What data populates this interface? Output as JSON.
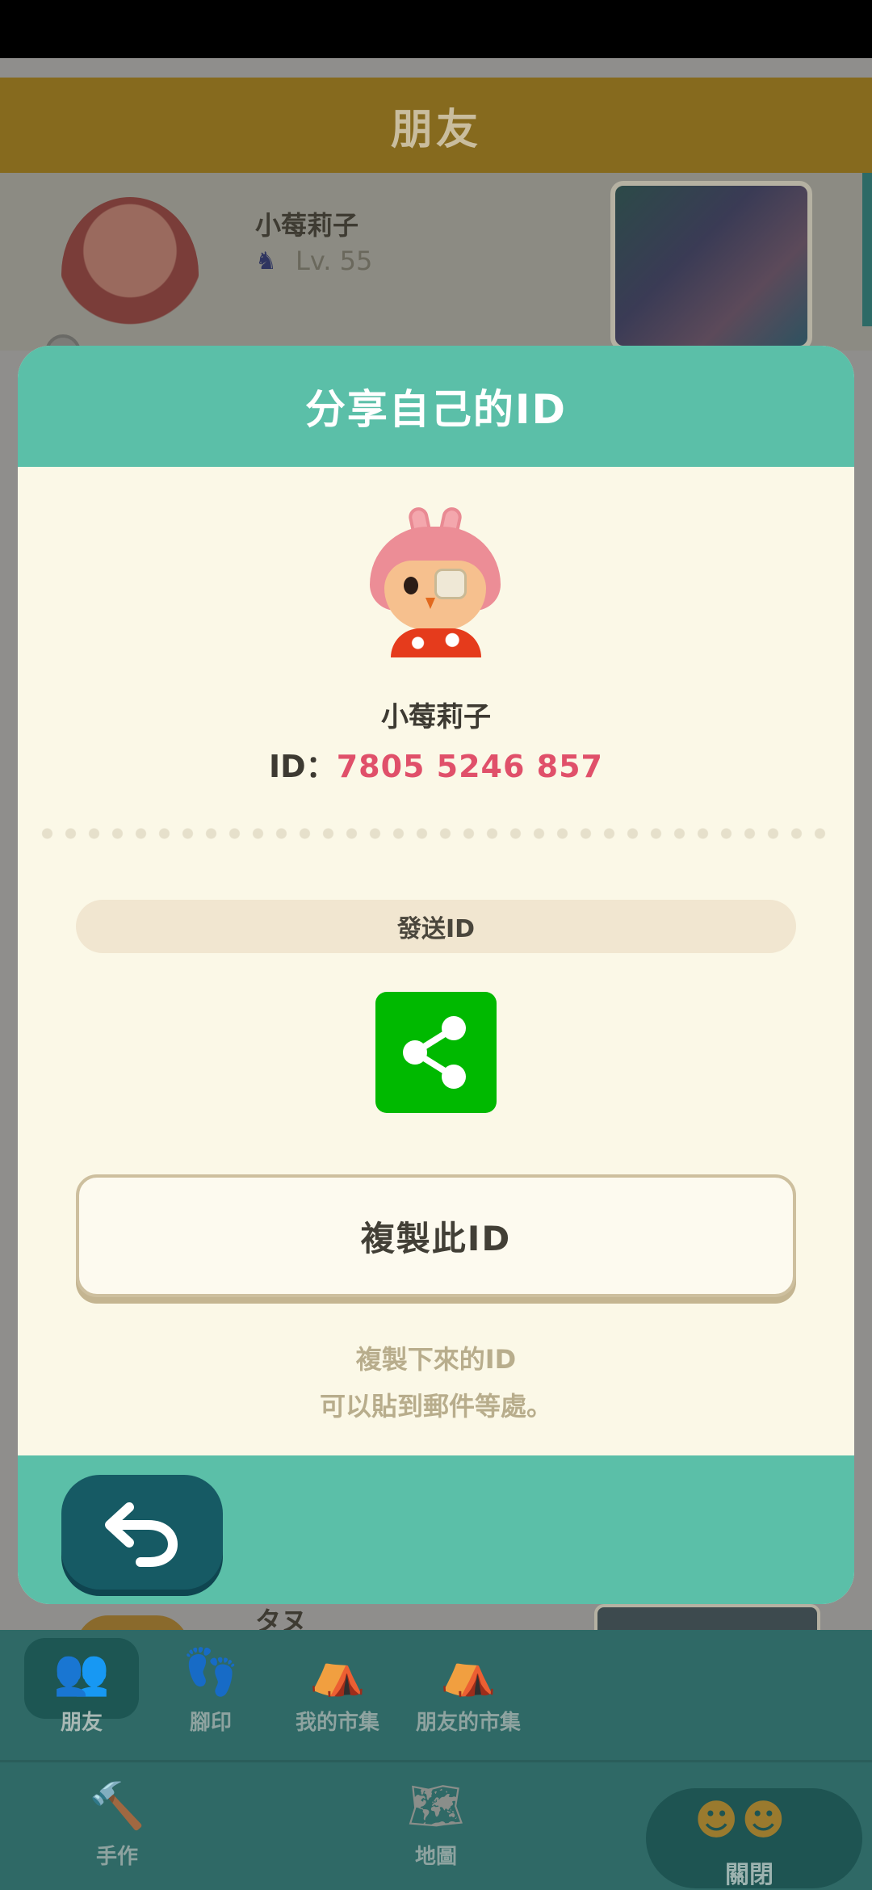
{
  "background": {
    "header_title": "朋友",
    "friends": [
      {
        "name": "小莓莉子",
        "level": "Lv. 55"
      },
      {
        "name": "タヌ"
      }
    ]
  },
  "nav": {
    "row1": [
      {
        "label": "朋友",
        "icon": "friends-icon",
        "active": true
      },
      {
        "label": "腳印",
        "icon": "footprints-icon"
      },
      {
        "label": "我的市集",
        "icon": "my-market-icon"
      },
      {
        "label": "朋友的市集",
        "icon": "friends-market-icon"
      }
    ],
    "row2": [
      {
        "label": "手作",
        "icon": "crafting-icon"
      },
      {
        "label": "地圖",
        "icon": "map-icon"
      }
    ],
    "close_label": "關閉"
  },
  "modal": {
    "title": "分享自己的ID",
    "player_name": "小莓莉子",
    "id_prefix": "ID：",
    "id_value": "7805 5246 857",
    "send_label": "發送ID",
    "copy_label": "複製此ID",
    "hint_line1": "複製下來的ID",
    "hint_line2": "可以貼到郵件等處。"
  },
  "colors": {
    "teal_accent": "#5bbfa8",
    "id_color": "#e0506a",
    "share_green": "#00b900",
    "back_button": "#165a64"
  }
}
